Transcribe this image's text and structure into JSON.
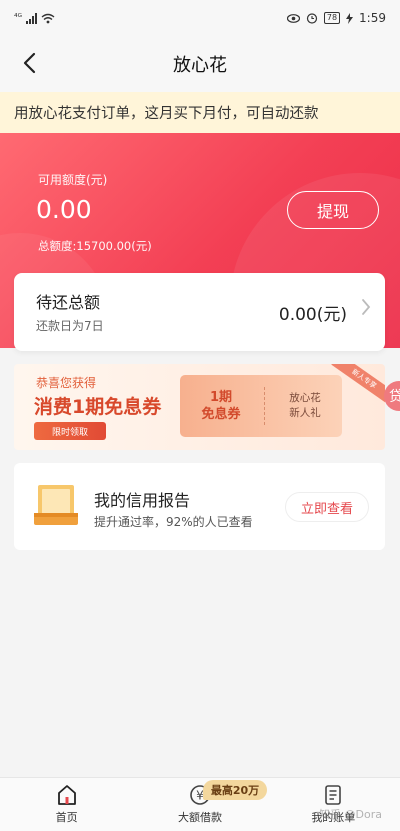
{
  "status_bar": {
    "network": "⁴ᴳ",
    "battery": "78",
    "time": "1:59"
  },
  "nav": {
    "title": "放心花"
  },
  "notice": {
    "text": "用放心花支付订单，这月买下月付，可自动还款"
  },
  "hero": {
    "available_label": "可用额度(元)",
    "available_amount": "0.00",
    "total_line": "总额度:15700.00(元)",
    "withdraw_label": "提现"
  },
  "repay": {
    "title": "待还总额",
    "due_text": "还款日为7日",
    "amount": "0.00(元)"
  },
  "promo": {
    "congrats": "恭喜您获得",
    "title": "消费1期免息券",
    "claim_label": "限时领取",
    "coupon_left_line1": "1期",
    "coupon_left_line2": "免息券",
    "coupon_right_line1": "放心花",
    "coupon_right_line2": "新人礼",
    "ribbon": "新人专享",
    "side_badge": "贷"
  },
  "credit": {
    "title": "我的信用报告",
    "subtitle": "提升通过率，92%的人已查看",
    "button_label": "立即查看"
  },
  "tabbar": {
    "tabs": [
      {
        "label": "首页",
        "icon": "home-icon"
      },
      {
        "label": "大额借款",
        "icon": "yuan-circle-icon"
      },
      {
        "label": "我的账单",
        "icon": "bill-icon"
      }
    ],
    "loan_badge": "最高20万"
  },
  "watermark": "知乎 @Dora",
  "colors": {
    "accent_red": "#f33f54",
    "notice_bg": "#fff5d9",
    "badge_gold": "#f3d79d"
  }
}
